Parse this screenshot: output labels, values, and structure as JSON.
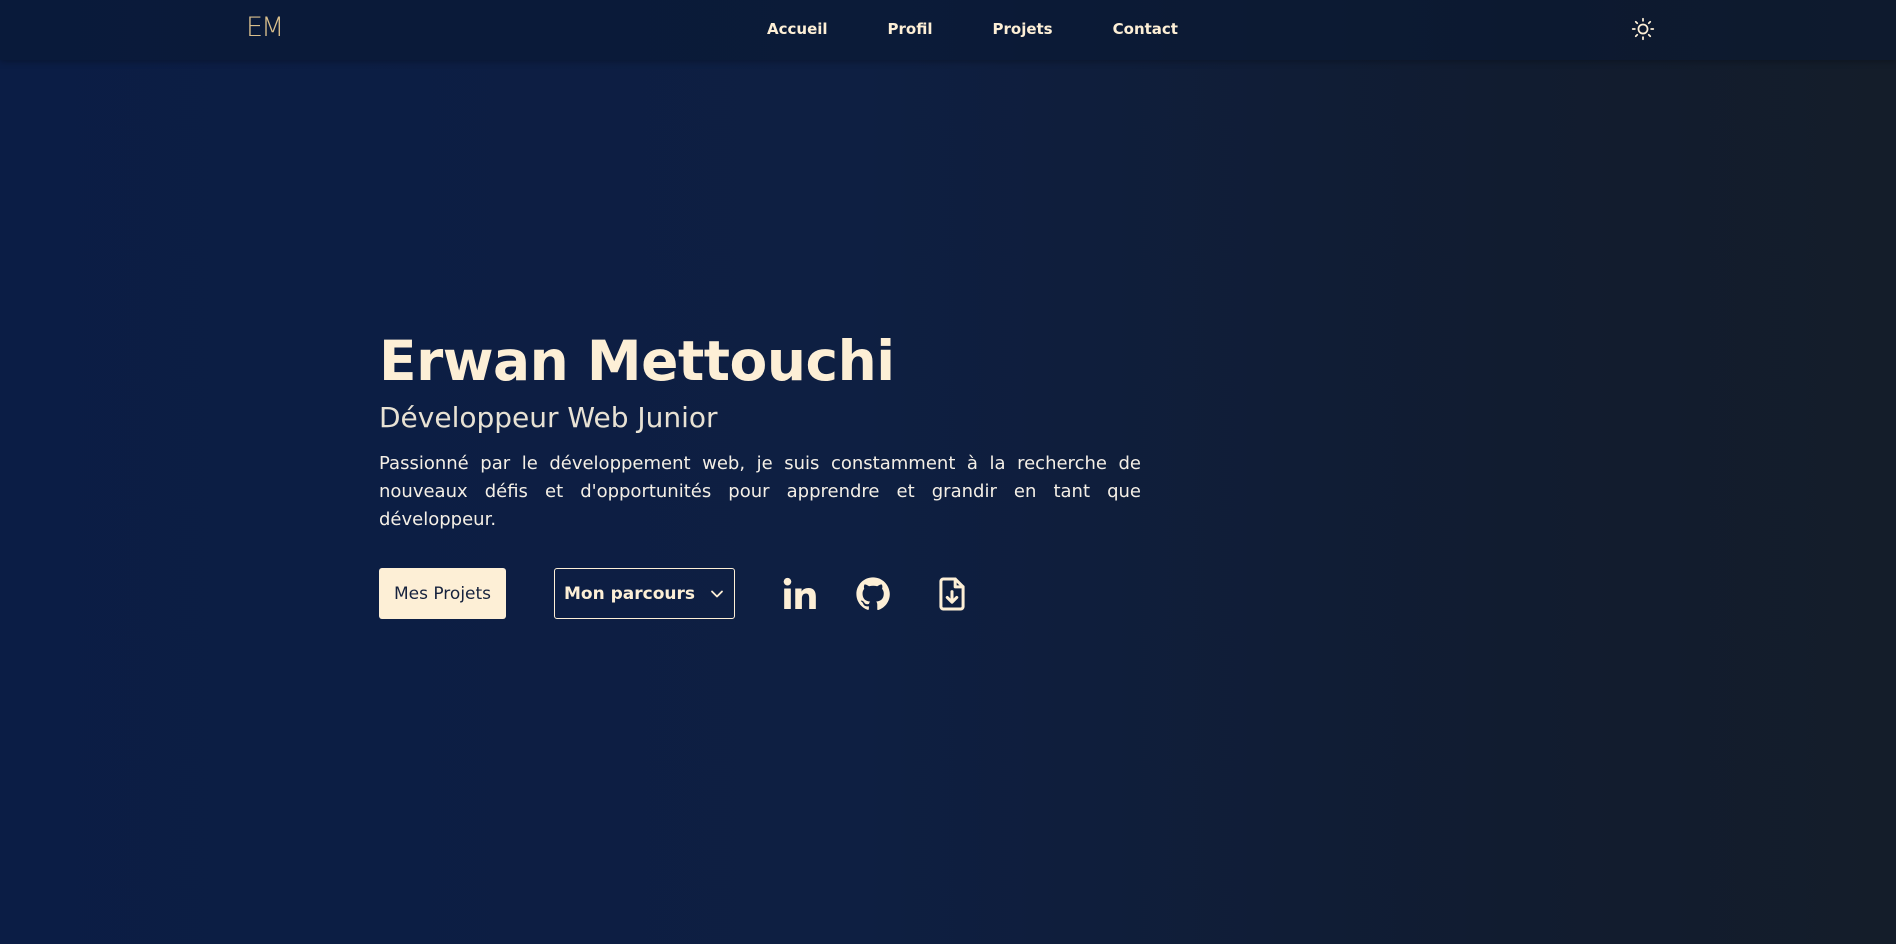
{
  "nav": {
    "logo": "EM",
    "links": [
      "Accueil",
      "Profil",
      "Projets",
      "Contact"
    ],
    "theme_toggle_icon": "sun-icon"
  },
  "hero": {
    "name": "Erwan Mettouchi",
    "role": "Développeur Web Junior",
    "description": "Passionné par le développement web, je suis constamment à la recherche de nouveaux défis et d'opportunités pour apprendre et grandir en tant que développeur."
  },
  "actions": {
    "primary_label": "Mes Projets",
    "dropdown_label": "Mon parcours",
    "dropdown_icon": "chevron-down-icon",
    "social_icons": [
      "linkedin-icon",
      "github-icon",
      "file-download-icon"
    ]
  },
  "colors": {
    "accent": "#fdefd6",
    "logo": "#d9bf8c",
    "background": "#0e1f42"
  }
}
